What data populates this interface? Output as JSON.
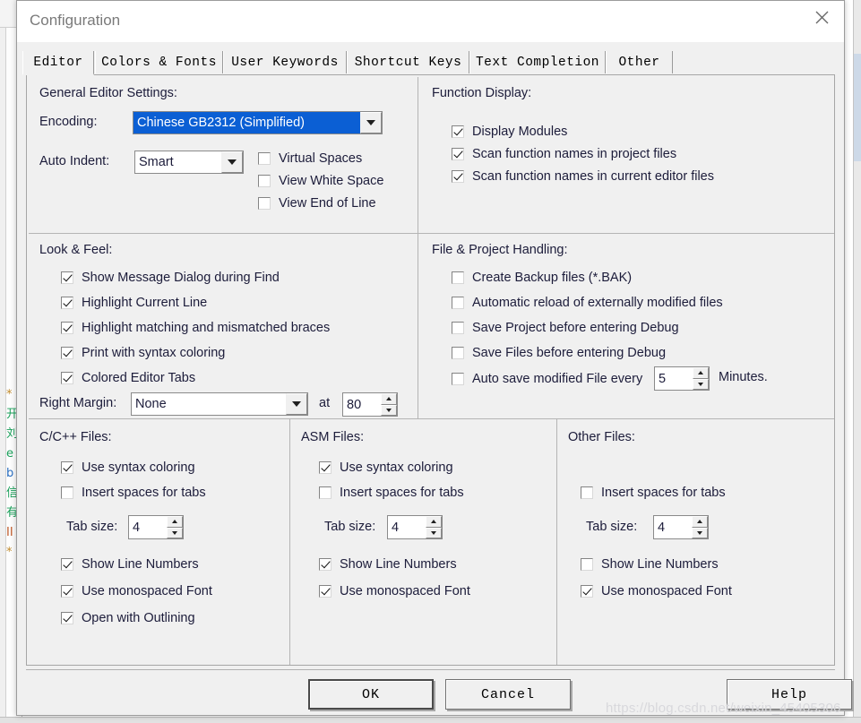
{
  "window": {
    "title": "Configuration",
    "close_icon": "close-icon"
  },
  "tabs": [
    {
      "label": "Editor",
      "active": true
    },
    {
      "label": "Colors & Fonts",
      "active": false
    },
    {
      "label": "User Keywords",
      "active": false
    },
    {
      "label": "Shortcut Keys",
      "active": false
    },
    {
      "label": "Text Completion",
      "active": false
    },
    {
      "label": "Other",
      "active": false
    }
  ],
  "general_editor_settings": {
    "title": "General Editor Settings:",
    "encoding_label": "Encoding:",
    "encoding_value": "Chinese GB2312 (Simplified)",
    "auto_indent_label": "Auto Indent:",
    "auto_indent_value": "Smart",
    "checkboxes": [
      {
        "label": "Virtual Spaces",
        "checked": false
      },
      {
        "label": "View White Space",
        "checked": false
      },
      {
        "label": "View End of Line",
        "checked": false
      }
    ]
  },
  "function_display": {
    "title": "Function Display:",
    "checkboxes": [
      {
        "label": "Display Modules",
        "checked": true
      },
      {
        "label": "Scan function names in project files",
        "checked": true
      },
      {
        "label": "Scan function names in current editor files",
        "checked": true
      }
    ]
  },
  "look_and_feel": {
    "title": "Look & Feel:",
    "checkboxes": [
      {
        "label": "Show Message Dialog during Find",
        "checked": true
      },
      {
        "label": "Highlight Current Line",
        "checked": true
      },
      {
        "label": "Highlight matching and mismatched braces",
        "checked": true
      },
      {
        "label": "Print with syntax coloring",
        "checked": true
      },
      {
        "label": "Colored Editor Tabs",
        "checked": true
      }
    ],
    "right_margin_label": "Right Margin:",
    "right_margin_value": "None",
    "at_label": "at",
    "at_value": "80"
  },
  "file_project_handling": {
    "title": "File & Project Handling:",
    "checkboxes": [
      {
        "label": "Create Backup files (*.BAK)",
        "checked": false
      },
      {
        "label": "Automatic reload of externally modified files",
        "checked": false
      },
      {
        "label": "Save Project before entering Debug",
        "checked": false
      },
      {
        "label": "Save Files before entering Debug",
        "checked": false
      }
    ],
    "autosave_label": "Auto save modified File every",
    "autosave_checked": false,
    "autosave_value": "5",
    "autosave_unit": "Minutes."
  },
  "c_cpp_files": {
    "title": "C/C++ Files:",
    "use_syntax_coloring": {
      "label": "Use syntax coloring",
      "checked": true
    },
    "insert_spaces": {
      "label": "Insert spaces for tabs",
      "checked": false
    },
    "tab_size_label": "Tab size:",
    "tab_size_value": "4",
    "show_line_numbers": {
      "label": "Show Line Numbers",
      "checked": true
    },
    "use_monospaced": {
      "label": "Use monospaced Font",
      "checked": true
    },
    "open_with_outlining": {
      "label": "Open with Outlining",
      "checked": true
    }
  },
  "asm_files": {
    "title": "ASM Files:",
    "use_syntax_coloring": {
      "label": "Use syntax coloring",
      "checked": true
    },
    "insert_spaces": {
      "label": "Insert spaces for tabs",
      "checked": false
    },
    "tab_size_label": "Tab size:",
    "tab_size_value": "4",
    "show_line_numbers": {
      "label": "Show Line Numbers",
      "checked": true
    },
    "use_monospaced": {
      "label": "Use monospaced Font",
      "checked": true
    }
  },
  "other_files": {
    "title": "Other Files:",
    "insert_spaces": {
      "label": "Insert spaces for tabs",
      "checked": false
    },
    "tab_size_label": "Tab size:",
    "tab_size_value": "4",
    "show_line_numbers": {
      "label": "Show Line Numbers",
      "checked": false
    },
    "use_monospaced": {
      "label": "Use monospaced Font",
      "checked": true
    }
  },
  "buttons": {
    "ok": "OK",
    "cancel": "Cancel",
    "help": "Help"
  },
  "watermark": "https://blog.csdn.net/weixin_45405306",
  "background_code_lines": [
    "*",
    "开",
    "刘",
    "e",
    "b",
    "信",
    "有",
    "II",
    "*"
  ]
}
